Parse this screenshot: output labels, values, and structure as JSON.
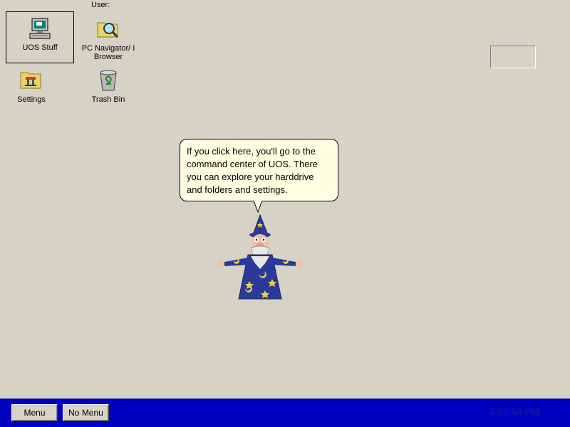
{
  "desktop": {
    "user_label": "User:",
    "icons": [
      {
        "label": "UOS Stuff",
        "icon": "computer-icon",
        "selected": true
      },
      {
        "label": "PC Navigator/ I Browser",
        "icon": "folder-search-icon"
      },
      {
        "label": "Settings",
        "icon": "settings-folder-icon"
      },
      {
        "label": "Trash Bin",
        "icon": "recycle-bin-icon"
      }
    ]
  },
  "balloon": {
    "text": "If you click here, you'll go to the command center of UOS. There you can explore your harddrive and folders and settings."
  },
  "assistant": {
    "icon": "wizard-icon"
  },
  "taskbar": {
    "menu_label": "Menu",
    "no_menu_label": "No Menu",
    "clock": "3:59:54 PM",
    "color": "#0000c0"
  }
}
